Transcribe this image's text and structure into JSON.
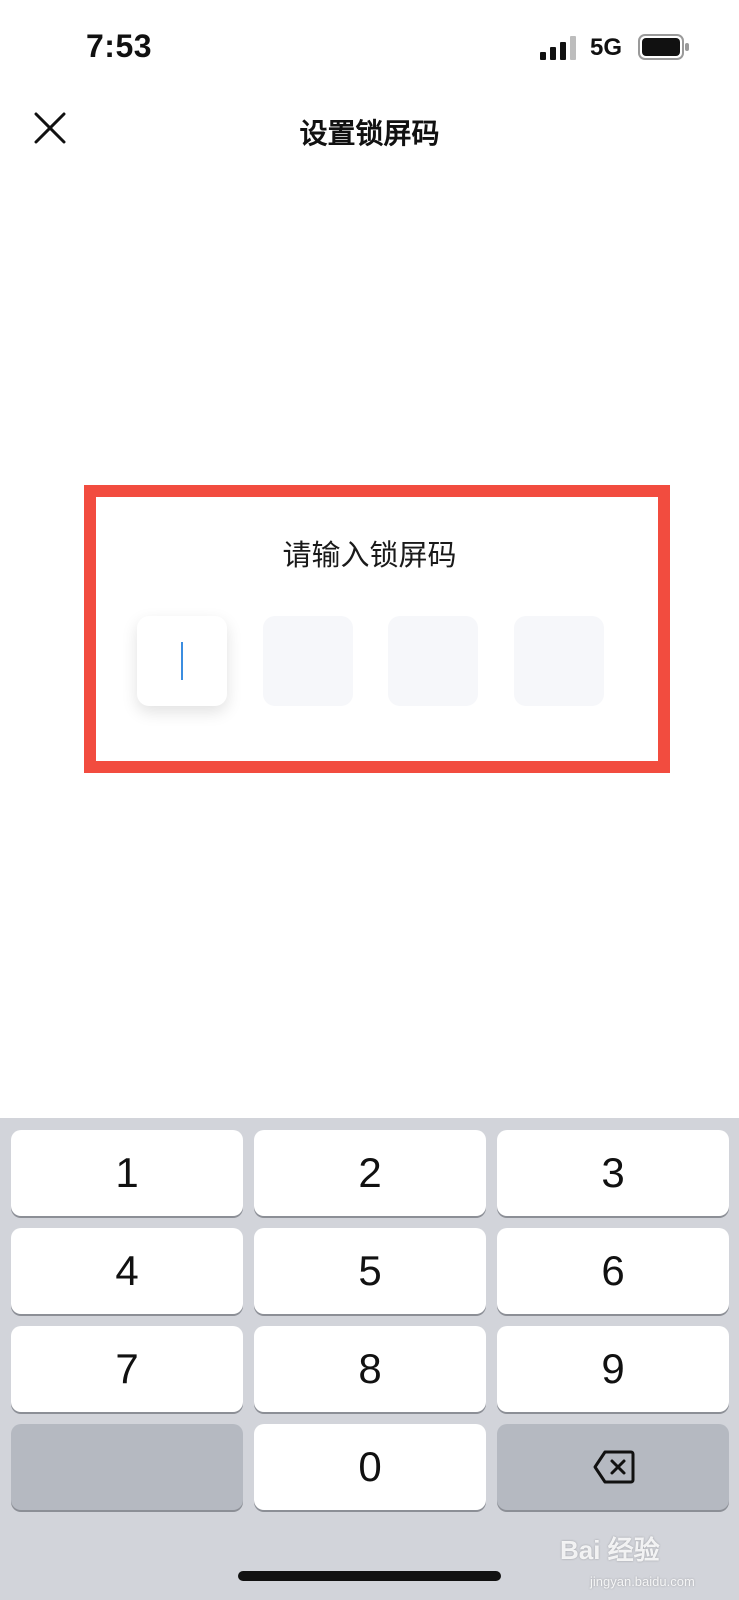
{
  "status_bar": {
    "time": "7:53",
    "network": "5G",
    "icons": [
      "signal-icon",
      "battery-icon"
    ]
  },
  "nav": {
    "title": "设置锁屏码",
    "close_icon": "close-icon"
  },
  "passcode": {
    "prompt": "请输入锁屏码",
    "digits": [
      "",
      "",
      "",
      ""
    ],
    "active_index": 0,
    "highlight_color": "#f24c3f"
  },
  "keyboard": {
    "keys": [
      "1",
      "2",
      "3",
      "4",
      "5",
      "6",
      "7",
      "8",
      "9",
      "",
      "0",
      ""
    ],
    "backspace_icon": "backspace-icon"
  },
  "watermark": {
    "brand": "Bai 经验",
    "url": "jingyan.baidu.com"
  },
  "colors": {
    "accent_caret": "#3b8de0",
    "keyboard_bg": "#d2d4da"
  }
}
